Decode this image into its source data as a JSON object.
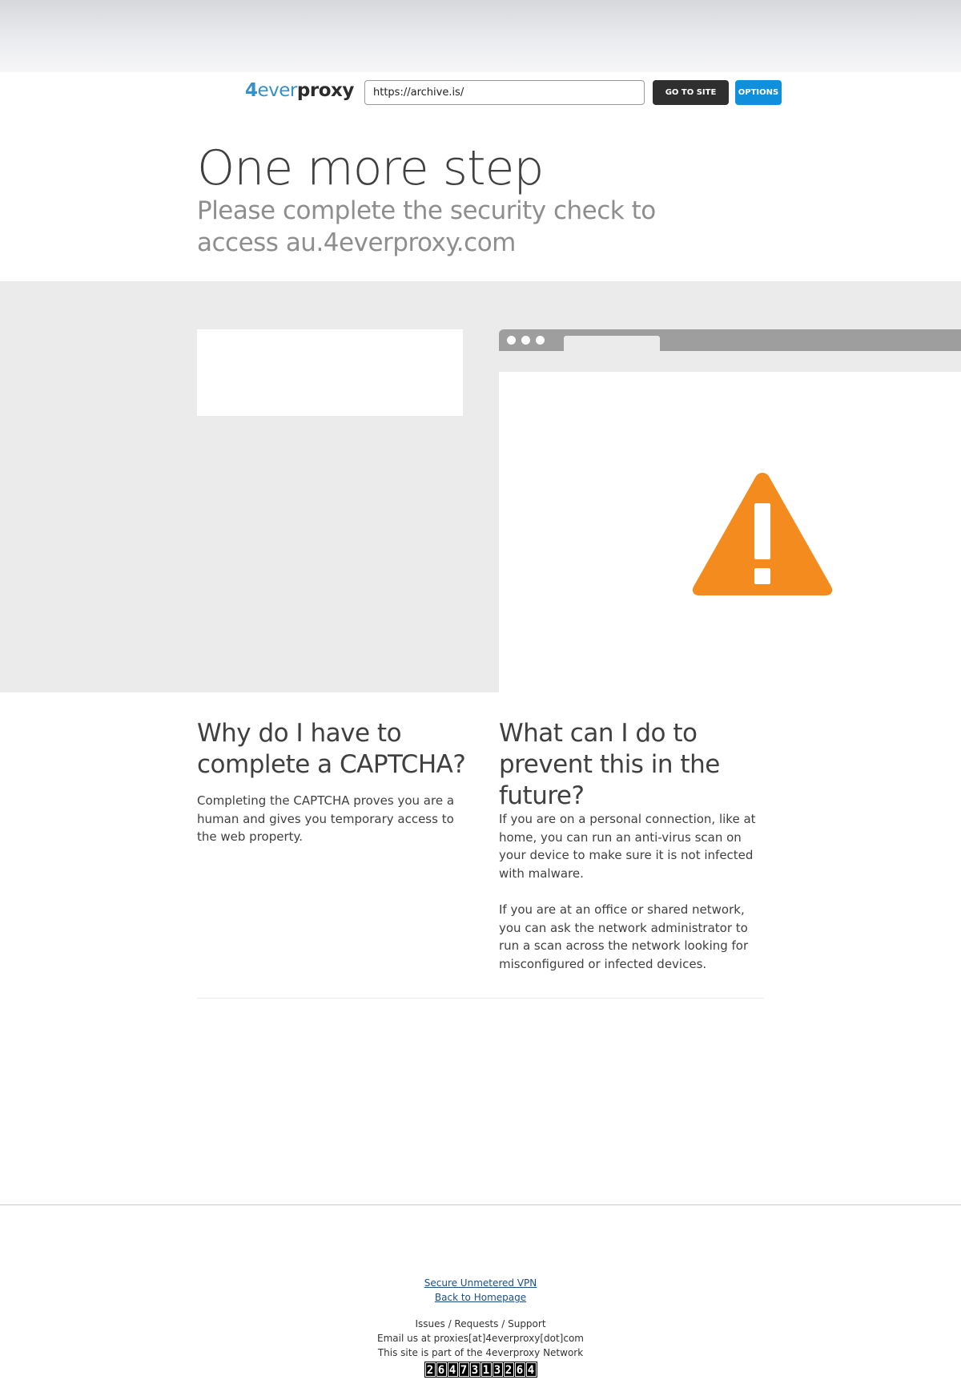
{
  "proxy": {
    "logo_prefix": "4",
    "logo_ever": "ever",
    "logo_proxy": "proxy",
    "url_value": "https://archive.is/",
    "go_button": "GO TO SITE",
    "options_button": "OPTIONS"
  },
  "header": {
    "title": "One more step",
    "subtitle": "Please complete the security check to access au.4everproxy.com"
  },
  "why": {
    "title": "Why do I have to complete a CAPTCHA?",
    "text": "Completing the CAPTCHA proves you are a human and gives you temporary access to the web property."
  },
  "prevent": {
    "title": "What can I do to prevent this in the future?",
    "text1": "If you are on a personal connection, like at home, you can run an anti-virus scan on your device to make sure it is not infected with malware.",
    "text2": "If you are at an office or shared network, you can ask the network administrator to run a scan across the network looking for misconfigured or infected devices."
  },
  "footer": {
    "vpn_link": "Secure Unmetered VPN",
    "home_link": "Back to Homepage",
    "issues": "Issues / Requests / Support",
    "email": "Email us at proxies[at]4everproxy[dot]com",
    "network": "This site is part of the 4everproxy Network",
    "counter_digits": [
      "2",
      "6",
      "4",
      "7",
      "3",
      "1",
      "3",
      "2",
      "6",
      "4"
    ]
  },
  "colors": {
    "warning": "#f48b1f",
    "options_button": "#0f8fdc",
    "go_button": "#2f2f2f",
    "band": "#ebebeb"
  }
}
